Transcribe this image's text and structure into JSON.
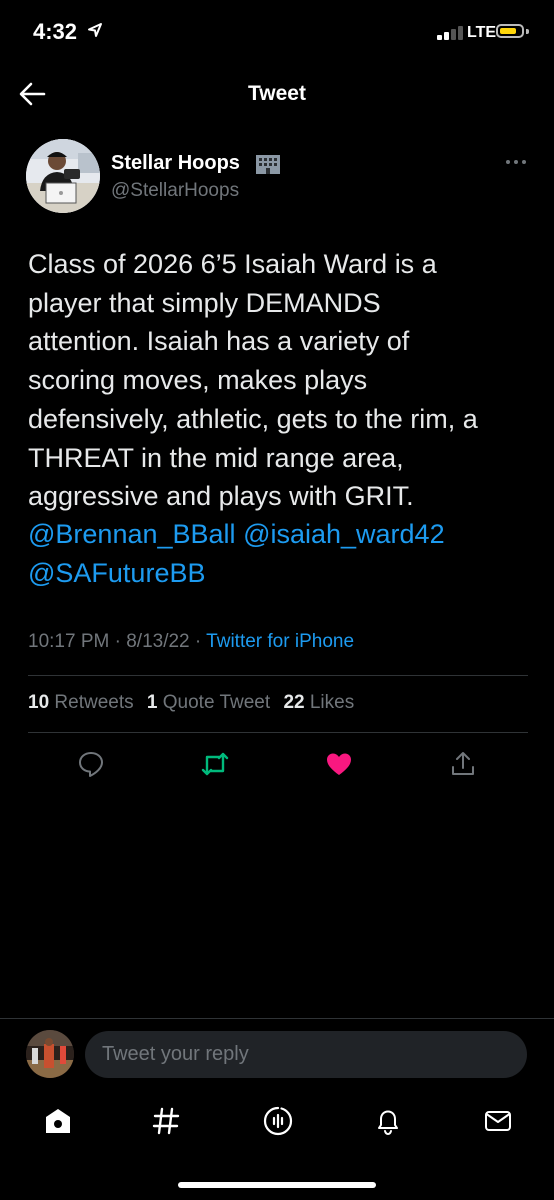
{
  "status_bar": {
    "time": "4:32",
    "network": "LTE"
  },
  "header": {
    "title": "Tweet"
  },
  "author": {
    "name": "Stellar Hoops",
    "handle": "@StellarHoops"
  },
  "tweet": {
    "text_lines": [
      "Class of 2026 6’5 Isaiah Ward is a",
      "player that simply DEMANDS",
      "attention. Isaiah has a variety of",
      "scoring moves, makes plays",
      "defensively, athletic, gets to the rim, a",
      "THREAT in the mid range area,",
      "aggressive and plays with GRIT."
    ],
    "mentions": [
      "@Brennan_BBall",
      "@isaiah_ward42",
      "@SAFutureBB"
    ],
    "time": "10:17 PM",
    "date": "8/13/22",
    "separator": "·",
    "source": "Twitter for iPhone"
  },
  "stats": {
    "retweets_count": "10",
    "retweets_label": "Retweets",
    "quotes_count": "1",
    "quotes_label": "Quote Tweet",
    "likes_count": "22",
    "likes_label": "Likes"
  },
  "actions": {
    "reply_icon": "reply-icon",
    "retweet_icon": "retweet-icon",
    "like_icon": "heart-filled-icon",
    "share_icon": "share-icon",
    "retweet_color": "#00ba7c",
    "like_color": "#f91880"
  },
  "reply": {
    "placeholder": "Tweet your reply"
  },
  "tab_bar": {
    "tabs": [
      "home-icon",
      "hashtag-icon",
      "spaces-icon",
      "bell-icon",
      "mail-icon"
    ]
  },
  "colors": {
    "background": "#000000",
    "link": "#1d9bf0",
    "secondary_text": "#71767b"
  }
}
